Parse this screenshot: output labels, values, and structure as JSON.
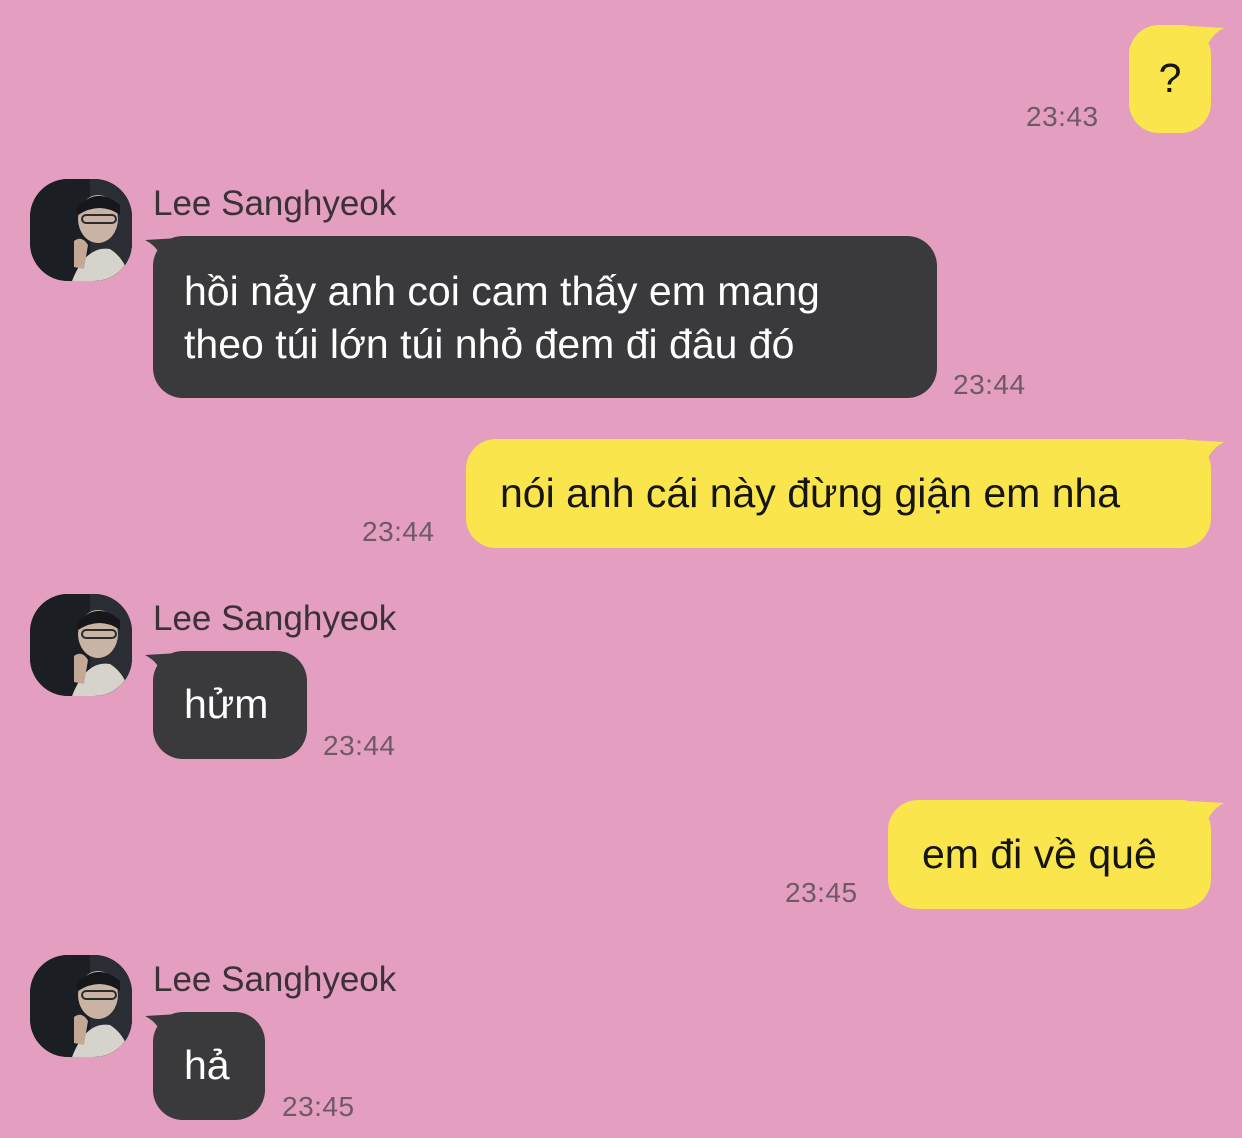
{
  "colors": {
    "background": "#e49ec0",
    "outgoing_bubble": "#fae54c",
    "incoming_bubble": "#3a3a3c",
    "timestamp": "#6e5a67"
  },
  "messages": [
    {
      "direction": "out",
      "lines": [
        "?"
      ],
      "time": "23:43"
    },
    {
      "direction": "in",
      "sender": "Lee Sanghyeok",
      "lines": [
        "hồi nảy anh coi cam thấy em mang",
        "theo túi lớn túi nhỏ đem đi đâu đó"
      ],
      "time": "23:44"
    },
    {
      "direction": "out",
      "lines": [
        "nói anh cái này đừng giận em nha"
      ],
      "time": "23:44"
    },
    {
      "direction": "in",
      "sender": "Lee Sanghyeok",
      "lines": [
        "hửm"
      ],
      "time": "23:44"
    },
    {
      "direction": "out",
      "lines": [
        "em đi về quê"
      ],
      "time": "23:45"
    },
    {
      "direction": "in",
      "sender": "Lee Sanghyeok",
      "lines": [
        "hả"
      ],
      "time": "23:45"
    }
  ]
}
